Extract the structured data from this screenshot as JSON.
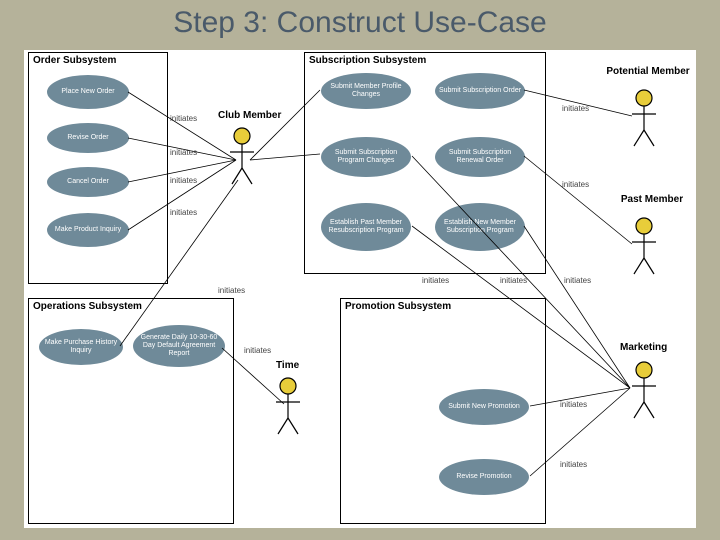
{
  "title": "Step 3: Construct Use-Case",
  "subsystems": {
    "order": {
      "name": "Order Subsystem",
      "useCases": [
        "Place New Order",
        "Revise Order",
        "Cancel Order",
        "Make Product Inquiry"
      ]
    },
    "subscription": {
      "name": "Subscription Subsystem",
      "useCases": [
        "Submit Member Profile Changes",
        "Submit Subscription Order",
        "Submit Subscription Program Changes",
        "Submit Subscription Renewal Order",
        "Establish Past Member Resubscription Program",
        "Establish New Member Subscription Program"
      ]
    },
    "operations": {
      "name": "Operations Subsystem",
      "useCases": [
        "Make Purchase History Inquiry",
        "Generate Daily 10-30-60 Day Default Agreement Report"
      ]
    },
    "promotion": {
      "name": "Promotion Subsystem",
      "useCases": [
        "Submit New Promotion",
        "Revise Promotion"
      ]
    }
  },
  "actors": {
    "clubMember": "Club Member",
    "potentialMember": "Potential Member",
    "pastMember": "Past Member",
    "marketing": "Marketing",
    "time": "Time"
  },
  "relation": "initiates"
}
